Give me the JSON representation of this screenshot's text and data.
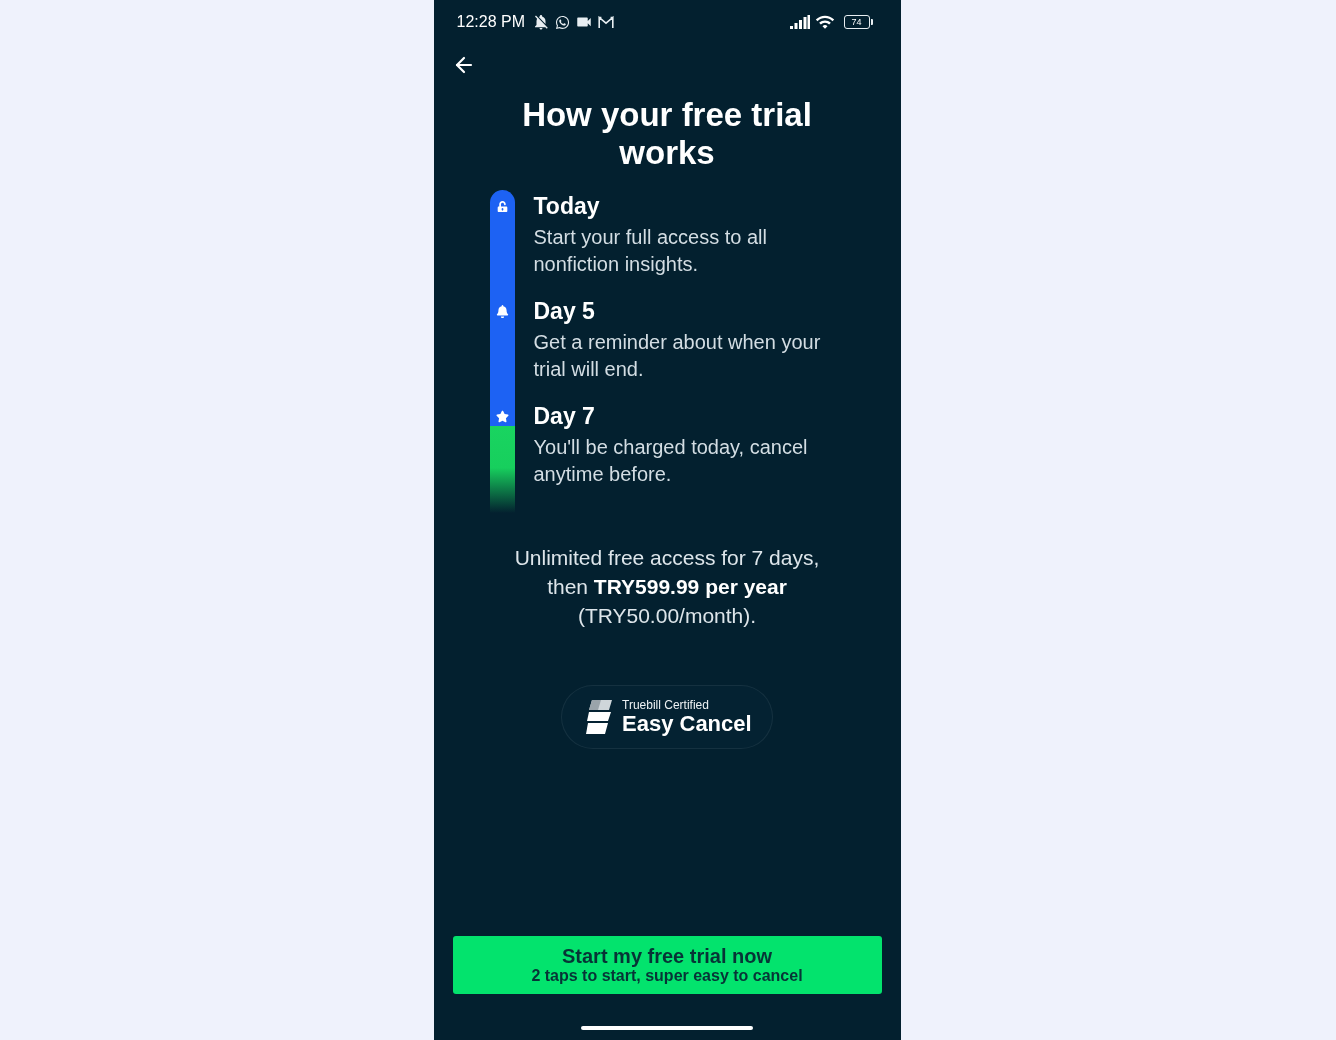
{
  "status_bar": {
    "time": "12:28 PM",
    "battery": "74"
  },
  "title": "How your free trial works",
  "timeline": [
    {
      "title": "Today",
      "description": "Start your full access to all nonfiction insights."
    },
    {
      "title": "Day 5",
      "description": "Get a reminder about when your trial will end."
    },
    {
      "title": "Day 7",
      "description": "You'll be charged today, cancel anytime before."
    }
  ],
  "price_note": "Unlimited free access for 7 days, then **TRY599.99 per year** (TRY50.00/month).",
  "badge": {
    "caption": "Truebill Certified",
    "title": "Easy Cancel"
  },
  "cta": {
    "label": "Start my free trial now",
    "sublabel": "2 taps to start, super easy to cancel"
  }
}
